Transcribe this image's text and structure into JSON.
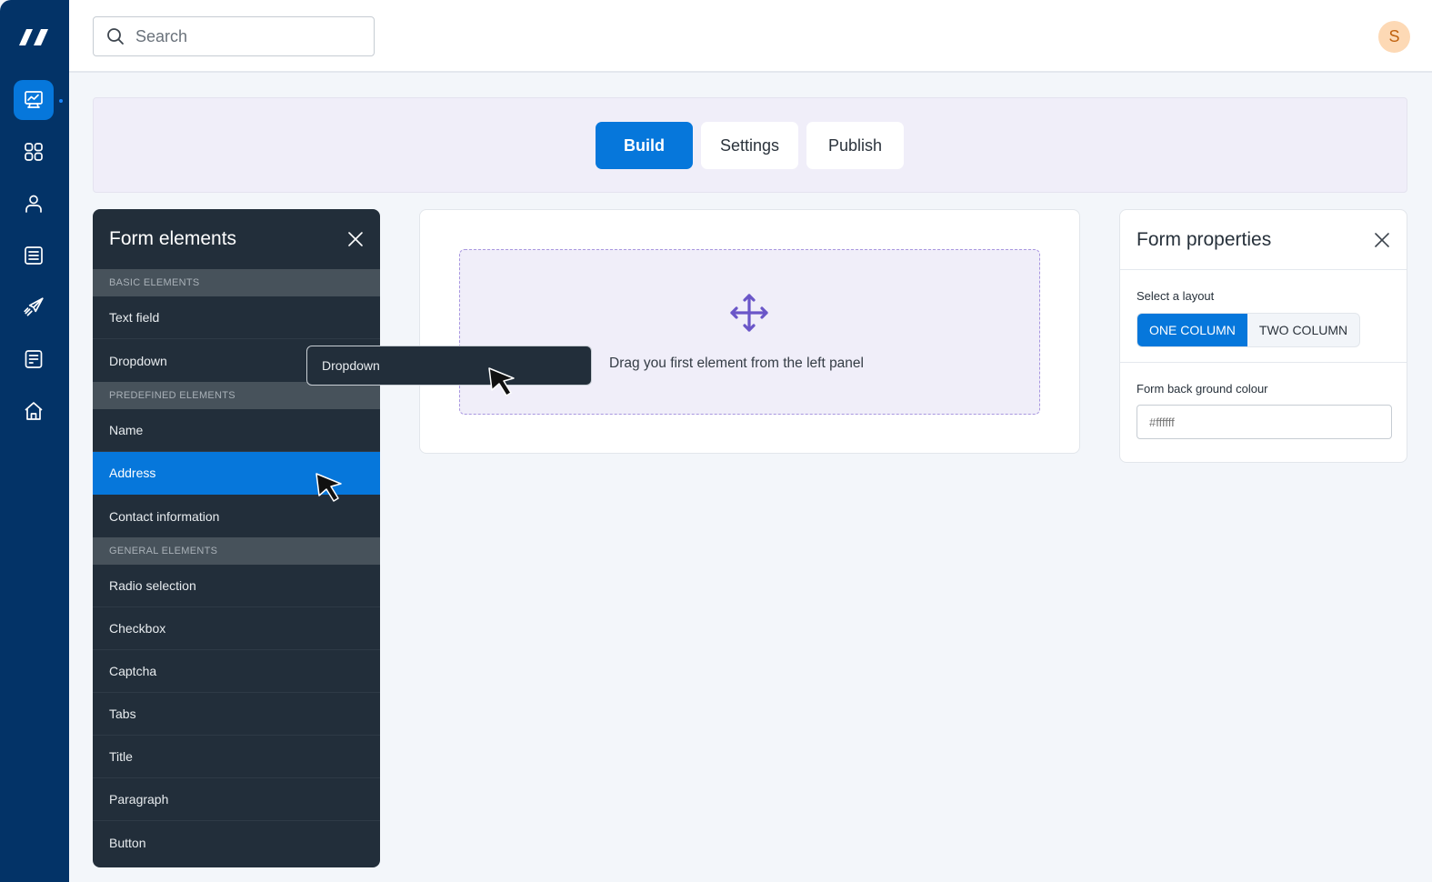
{
  "app": {
    "brand_color": "#0677db",
    "rail_color": "#033367"
  },
  "sidebar": {
    "items": [
      {
        "name": "analytics",
        "icon": "monitor-chart-icon",
        "active": true
      },
      {
        "name": "apps",
        "icon": "grid-icon",
        "active": false
      },
      {
        "name": "users",
        "icon": "user-icon",
        "active": false
      },
      {
        "name": "list",
        "icon": "list-icon",
        "active": false
      },
      {
        "name": "campaigns",
        "icon": "paper-plane-icon",
        "active": false
      },
      {
        "name": "documents",
        "icon": "document-icon",
        "active": false
      },
      {
        "name": "home",
        "icon": "home-icon",
        "active": false
      }
    ]
  },
  "header": {
    "search_placeholder": "Search",
    "search_value": "",
    "avatar_initial": "S"
  },
  "tabs": [
    {
      "label": "Build",
      "active": true
    },
    {
      "label": "Settings",
      "active": false
    },
    {
      "label": "Publish",
      "active": false
    }
  ],
  "form_elements": {
    "title": "Form elements",
    "sections": [
      {
        "label": "BASIC ELEMENTS",
        "items": [
          "Text field",
          "Dropdown"
        ]
      },
      {
        "label": "PREDEFINED ELEMENTS",
        "items": [
          "Name",
          "Address",
          "Contact information"
        ]
      },
      {
        "label": "GENERAL ELEMENTS",
        "items": [
          "Radio selection",
          "Checkbox",
          "Captcha",
          "Tabs",
          "Title",
          "Paragraph",
          "Button"
        ]
      }
    ],
    "selected_item": "Address"
  },
  "canvas": {
    "drop_message": "Drag you first element from the left panel",
    "dragging_item": "Dropdown"
  },
  "form_properties": {
    "title": "Form properties",
    "layout_label": "Select a layout",
    "layout_options": [
      "ONE COLUMN",
      "TWO COLUMN"
    ],
    "layout_selected": "ONE COLUMN",
    "bg_label": "Form back ground colour",
    "bg_placeholder": "#ffffff",
    "bg_value": ""
  }
}
